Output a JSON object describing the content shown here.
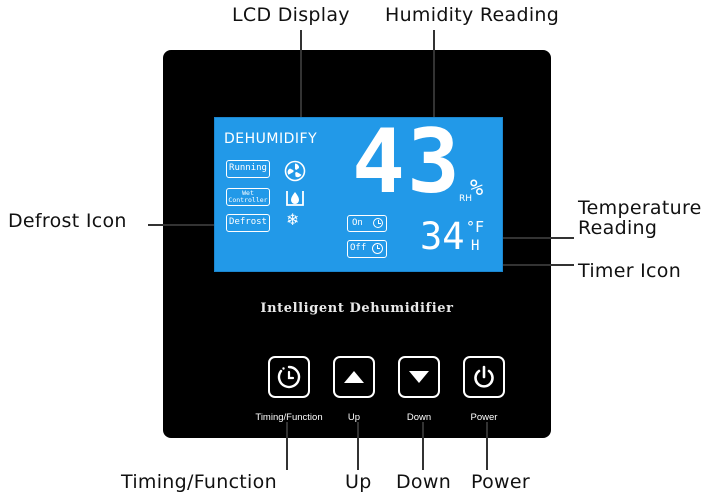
{
  "callouts": {
    "lcd_display": "LCD Display",
    "humidity_reading": "Humidity Reading",
    "defrost_icon": "Defrost Icon",
    "temperature_reading": "Temperature\nReading",
    "timer_icon": "Timer Icon",
    "timing_function": "Timing/Function",
    "up": "Up",
    "down": "Down",
    "power": "Power"
  },
  "lcd": {
    "mode": "DEHUMIDIFY",
    "indicators": [
      "Running",
      "Wet\nController",
      "Defrost"
    ],
    "humidity": "43",
    "humidity_unit_small": "RH",
    "humidity_unit": "%",
    "timer_on": "On",
    "timer_off": "Off",
    "temperature": "34",
    "temp_unit": "°F",
    "hour_unit": "H"
  },
  "brand": "Intelligent Dehumidifier",
  "buttons": [
    {
      "label": "Timing/Function",
      "icon": "timer-icon"
    },
    {
      "label": "Up",
      "icon": "up-arrow-icon"
    },
    {
      "label": "Down",
      "icon": "down-arrow-icon"
    },
    {
      "label": "Power",
      "icon": "power-icon"
    }
  ],
  "colors": {
    "panel": "#000000",
    "lcd_background": "#2299e8",
    "lcd_foreground": "#ffffff"
  }
}
